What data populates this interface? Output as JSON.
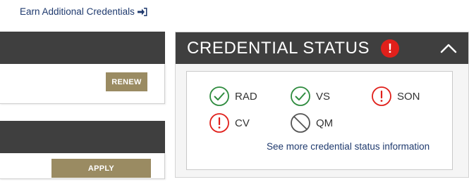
{
  "links": {
    "earn_additional_credentials": "Earn Additional Credentials"
  },
  "left_cards": {
    "renew_button": "RENEW",
    "apply_button": "APPLY"
  },
  "credential_status": {
    "title": "CREDENTIAL STATUS",
    "alert_symbol": "!",
    "credentials": [
      {
        "code": "RAD",
        "status": "active",
        "icon": "check-circle-icon",
        "color": "#2e8b3e"
      },
      {
        "code": "VS",
        "status": "active",
        "icon": "check-circle-icon",
        "color": "#2e8b3e"
      },
      {
        "code": "SON",
        "status": "alert",
        "icon": "exclamation-circle-icon",
        "color": "#e0201b"
      },
      {
        "code": "CV",
        "status": "alert",
        "icon": "exclamation-circle-icon",
        "color": "#e0201b"
      },
      {
        "code": "QM",
        "status": "not-held",
        "icon": "prohibited-circle-icon",
        "color": "#555555"
      }
    ],
    "more_link": "See more credential status information"
  },
  "colors": {
    "header_bg": "#3f3f3f",
    "button_tan": "#9a8b62",
    "link_blue": "#1f3a6e",
    "alert_red": "#e0201b",
    "check_green": "#2e8b3e"
  }
}
